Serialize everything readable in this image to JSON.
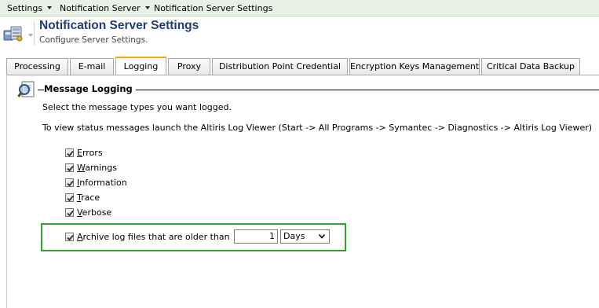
{
  "menubar": {
    "items": [
      {
        "label": "Settings",
        "has_dropdown": true
      },
      {
        "label": "Notification Server",
        "has_dropdown": true
      },
      {
        "label": "Notification Server Settings",
        "has_dropdown": false
      }
    ]
  },
  "header": {
    "title": "Notification Server Settings",
    "subtitle": "Configure Server Settings.",
    "icon": "server-settings-icon"
  },
  "tabs": [
    {
      "label": "Processing",
      "active": false
    },
    {
      "label": "E-mail",
      "active": false
    },
    {
      "label": "Logging",
      "active": true
    },
    {
      "label": "Proxy",
      "active": false
    },
    {
      "label": "Distribution Point Credential",
      "active": false
    },
    {
      "label": "Encryption Keys Management",
      "active": false
    },
    {
      "label": "Critical Data Backup",
      "active": false
    }
  ],
  "section": {
    "title": "Message Logging",
    "icon": "magnifier-document-icon",
    "instruction": "Select the message types you want logged.",
    "viewer_note": "To view status messages launch the Altiris Log Viewer (Start -> All Programs -> Symantec -> Diagnostics -> Altiris Log Viewer)"
  },
  "log_types": [
    {
      "access_key": "E",
      "rest": "rrors",
      "checked": true
    },
    {
      "access_key": "W",
      "rest": "arnings",
      "checked": true
    },
    {
      "access_key": "I",
      "rest": "nformation",
      "checked": true
    },
    {
      "access_key": "T",
      "rest": "race",
      "checked": true
    },
    {
      "access_key": "V",
      "rest": "erbose",
      "checked": true
    }
  ],
  "archive": {
    "checked": true,
    "access_key": "A",
    "label_rest": "rchive log files that are older than",
    "value": "1",
    "unit": "Days"
  },
  "colors": {
    "title": "#1f3d73",
    "active_tab_accent": "#f2a51e",
    "highlight_box": "#2ea12e",
    "menubar_bg": "#e9f0e6"
  }
}
